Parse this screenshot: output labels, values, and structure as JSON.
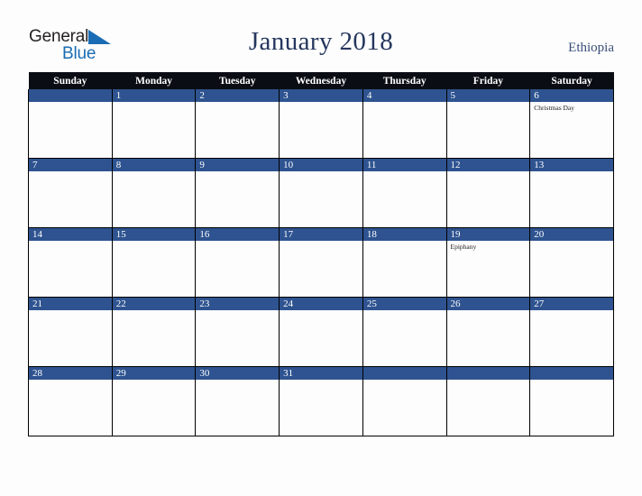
{
  "brand": {
    "name_part1": "General",
    "name_part2": "Blue",
    "triangle_color": "#1a6cb5"
  },
  "header": {
    "title": "January 2018",
    "country": "Ethiopia"
  },
  "colors": {
    "header_row_bg": "#0a0e14",
    "day_bar_bg": "#2e5390",
    "title_text": "#25375e",
    "country_text": "#3a4f77",
    "page_bg": "#fdfdfd",
    "grid_line": "#000000"
  },
  "calendar": {
    "weekday_headers": [
      "Sunday",
      "Monday",
      "Tuesday",
      "Wednesday",
      "Thursday",
      "Friday",
      "Saturday"
    ],
    "weeks": [
      [
        {
          "day": "",
          "events": []
        },
        {
          "day": "1",
          "events": []
        },
        {
          "day": "2",
          "events": []
        },
        {
          "day": "3",
          "events": []
        },
        {
          "day": "4",
          "events": []
        },
        {
          "day": "5",
          "events": []
        },
        {
          "day": "6",
          "events": [
            "Christmas Day"
          ]
        }
      ],
      [
        {
          "day": "7",
          "events": []
        },
        {
          "day": "8",
          "events": []
        },
        {
          "day": "9",
          "events": []
        },
        {
          "day": "10",
          "events": []
        },
        {
          "day": "11",
          "events": []
        },
        {
          "day": "12",
          "events": []
        },
        {
          "day": "13",
          "events": []
        }
      ],
      [
        {
          "day": "14",
          "events": []
        },
        {
          "day": "15",
          "events": []
        },
        {
          "day": "16",
          "events": []
        },
        {
          "day": "17",
          "events": []
        },
        {
          "day": "18",
          "events": []
        },
        {
          "day": "19",
          "events": [
            "Epiphany"
          ]
        },
        {
          "day": "20",
          "events": []
        }
      ],
      [
        {
          "day": "21",
          "events": []
        },
        {
          "day": "22",
          "events": []
        },
        {
          "day": "23",
          "events": []
        },
        {
          "day": "24",
          "events": []
        },
        {
          "day": "25",
          "events": []
        },
        {
          "day": "26",
          "events": []
        },
        {
          "day": "27",
          "events": []
        }
      ],
      [
        {
          "day": "28",
          "events": []
        },
        {
          "day": "29",
          "events": []
        },
        {
          "day": "30",
          "events": []
        },
        {
          "day": "31",
          "events": []
        },
        {
          "day": "",
          "events": []
        },
        {
          "day": "",
          "events": []
        },
        {
          "day": "",
          "events": []
        }
      ]
    ]
  }
}
